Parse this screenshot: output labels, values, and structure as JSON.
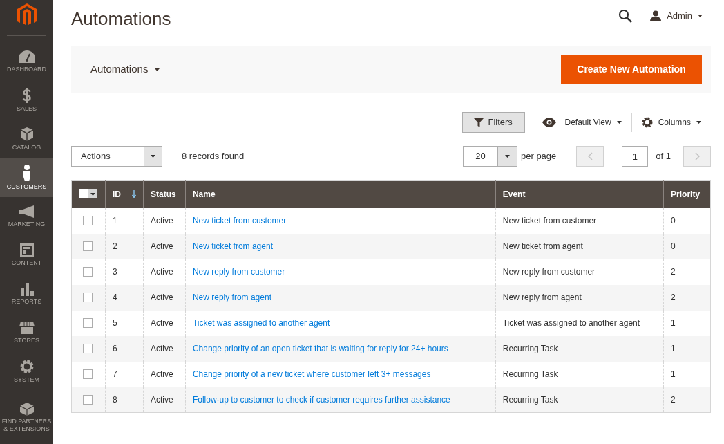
{
  "sidebar": {
    "items": [
      {
        "label": "DASHBOARD",
        "selected": false
      },
      {
        "label": "SALES",
        "selected": false
      },
      {
        "label": "CATALOG",
        "selected": false
      },
      {
        "label": "CUSTOMERS",
        "selected": true
      },
      {
        "label": "MARKETING",
        "selected": false
      },
      {
        "label": "CONTENT",
        "selected": false
      },
      {
        "label": "REPORTS",
        "selected": false
      },
      {
        "label": "STORES",
        "selected": false
      },
      {
        "label": "SYSTEM",
        "selected": false
      },
      {
        "label": "FIND PARTNERS & EXTENSIONS",
        "selected": false
      }
    ]
  },
  "header": {
    "title": "Automations",
    "user": "Admin"
  },
  "page_actions": {
    "switcher": "Automations",
    "create_button": "Create New Automation"
  },
  "toolbar": {
    "filters": "Filters",
    "view": "Default View",
    "columns": "Columns",
    "actions": "Actions",
    "records": "8 records found",
    "per_page_value": "20",
    "per_page_label": "per page",
    "page": "1",
    "of_pages": "of 1"
  },
  "table": {
    "mass_select_checked": false,
    "columns": [
      {
        "label": "ID",
        "sorted": true
      },
      {
        "label": "Status",
        "sorted": false
      },
      {
        "label": "Name",
        "sorted": false
      },
      {
        "label": "Event",
        "sorted": false
      },
      {
        "label": "Priority",
        "sorted": false
      }
    ],
    "rows": [
      {
        "checked": false,
        "cells": [
          "1",
          "Active",
          "New ticket from customer",
          "New ticket from customer",
          "0"
        ]
      },
      {
        "checked": false,
        "cells": [
          "2",
          "Active",
          "New ticket from agent",
          "New ticket from agent",
          "0"
        ]
      },
      {
        "checked": false,
        "cells": [
          "3",
          "Active",
          "New reply from customer",
          "New reply from customer",
          "2"
        ]
      },
      {
        "checked": false,
        "cells": [
          "4",
          "Active",
          "New reply from agent",
          "New reply from agent",
          "2"
        ]
      },
      {
        "checked": false,
        "cells": [
          "5",
          "Active",
          "Ticket was assigned to another agent",
          "Ticket was assigned to another agent",
          "1"
        ]
      },
      {
        "checked": false,
        "cells": [
          "6",
          "Active",
          "Change priority of an open ticket that is waiting for reply for 24+ hours",
          "Recurring Task",
          "1"
        ]
      },
      {
        "checked": false,
        "cells": [
          "7",
          "Active",
          "Change priority of a new ticket where customer left 3+ messages",
          "Recurring Task",
          "1"
        ]
      },
      {
        "checked": false,
        "cells": [
          "8",
          "Active",
          "Follow-up to customer to check if customer requires further assistance",
          "Recurring Task",
          "2"
        ]
      }
    ]
  }
}
